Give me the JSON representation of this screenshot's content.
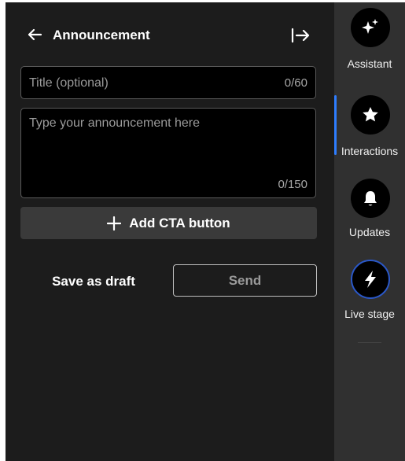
{
  "header": {
    "title": "Announcement",
    "back_icon": "arrow-left-icon",
    "collapse_icon": "collapse-right-icon"
  },
  "form": {
    "title_placeholder": "Title (optional)",
    "title_value": "",
    "title_counter": "0/60",
    "message_placeholder": "Type your announcement here",
    "message_value": "",
    "message_counter": "0/150",
    "cta_label": "Add CTA button",
    "cta_icon": "plus-icon"
  },
  "actions": {
    "draft_label": "Save as draft",
    "send_label": "Send"
  },
  "rail": {
    "items": [
      {
        "label": "Assistant",
        "icon": "sparkle-icon"
      },
      {
        "label": "Interactions",
        "icon": "star-icon"
      },
      {
        "label": "Updates",
        "icon": "bell-icon"
      },
      {
        "label": "Live stage",
        "icon": "lightning-icon"
      }
    ]
  },
  "colors": {
    "panel_bg": "#1c1c1c",
    "rail_bg": "#303030",
    "field_bg": "#000000",
    "cta_bg": "#3a3a3a",
    "active_accent": "#2e7dff",
    "live_ring": "#2a58c9"
  }
}
